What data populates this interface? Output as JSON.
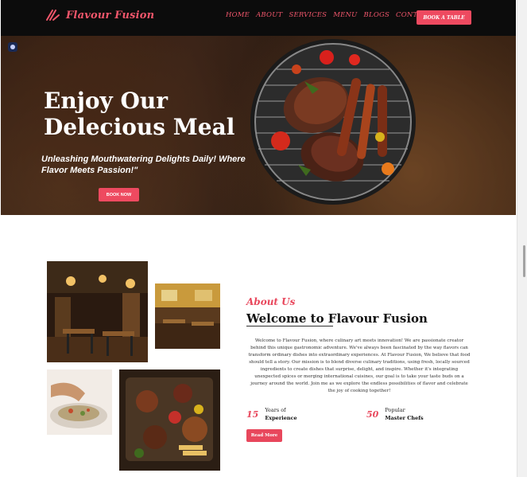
{
  "brand": {
    "name": "Flavour Fusion",
    "color": "#ee4a60"
  },
  "nav": {
    "links": [
      "HOME",
      "ABOUT",
      "SERVICES",
      "MENU",
      "BLOGS",
      "CONTACT"
    ],
    "cta": "BOOK A TABLE"
  },
  "hero": {
    "title": "Enjoy Our Delecious Meal",
    "subtitle": "Unleashing Mouthwatering Delights Daily! Where Flavor Meets Passion!\"",
    "button": "BOOK NOW"
  },
  "about": {
    "kicker": "About Us",
    "title": "Welcome to Flavour Fusion",
    "body": "Welcome to Flavour Fusion, where culinary art meets innovation! We are passionate creator behind this unique gastronomic adventure. We've always been fascinated by the way flavors can transform ordinary dishes into extraordinary experiences. At Flavour Fusion, We believe that food should tell a story. Our mission is to blend diverse culinary traditions, using fresh, locally sourced ingredients to create dishes that surprise, delight, and inspire. Whether it's integrating unexpected spices or merging international cuisines, our goal is to take your taste buds on a journey around the world. Join me as we explore the endless possibilities of flavor and celebrate the joy of cooking together!",
    "stats": [
      {
        "number": "15",
        "label1": "Years of",
        "label2": "Experience"
      },
      {
        "number": "50",
        "label1": "Popular",
        "label2": "Master Chefs"
      }
    ],
    "button": "Read More"
  },
  "icons": [
    "logo-mark-icon",
    "camera-icon"
  ]
}
